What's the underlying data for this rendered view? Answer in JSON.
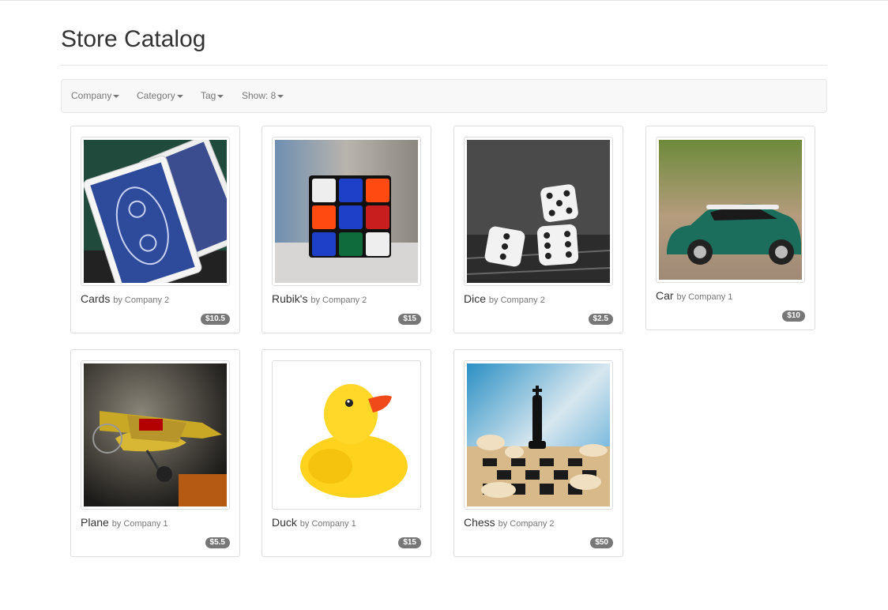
{
  "page": {
    "title": "Store Catalog"
  },
  "navbar": {
    "company": "Company",
    "category": "Category",
    "tag": "Tag",
    "show": "Show: 8"
  },
  "products": [
    {
      "name": "Cards",
      "company": "by Company 2",
      "price": "$10.5",
      "image": "playing-cards-image"
    },
    {
      "name": "Rubik's",
      "company": "by Company 2",
      "price": "$15",
      "image": "rubiks-cube-image"
    },
    {
      "name": "Dice",
      "company": "by Company 2",
      "price": "$2.5",
      "image": "dice-image"
    },
    {
      "name": "Car",
      "company": "by Company 1",
      "price": "$10",
      "image": "toy-car-image"
    },
    {
      "name": "Plane",
      "company": "by Company 1",
      "price": "$5.5",
      "image": "toy-plane-image"
    },
    {
      "name": "Duck",
      "company": "by Company 1",
      "price": "$15",
      "image": "rubber-duck-image"
    },
    {
      "name": "Chess",
      "company": "by Company 2",
      "price": "$50",
      "image": "chess-image"
    }
  ],
  "colors": {
    "badge": "#777777",
    "navbar_bg": "#f8f8f8",
    "border": "#dddddd"
  }
}
